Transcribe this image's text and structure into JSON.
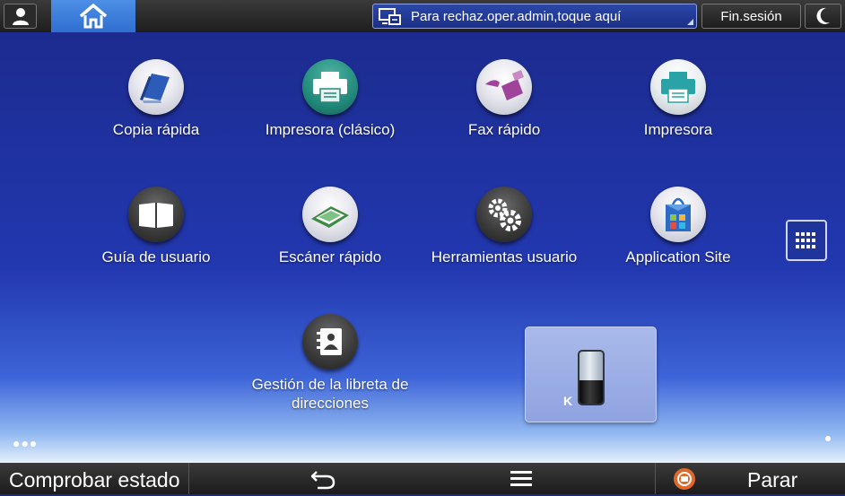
{
  "topbar": {
    "user_icon": "user-icon",
    "home_icon": "home-icon",
    "message": "Para rechaz.oper.admin,toque aquí",
    "message_icon": "monitor-icon",
    "logout_label": "Fin.sesión",
    "sleep_icon": "moon-icon"
  },
  "apps": [
    {
      "label": "Copia rápida",
      "icon": "copy-icon"
    },
    {
      "label": "Impresora (clásico)",
      "icon": "printer-icon"
    },
    {
      "label": "Fax rápido",
      "icon": "fax-icon"
    },
    {
      "label": "Impresora",
      "icon": "printer-icon"
    },
    {
      "label": "Guía de usuario",
      "icon": "book-icon"
    },
    {
      "label": "Escáner rápido",
      "icon": "scanner-icon"
    },
    {
      "label": "Herramientas usuario",
      "icon": "gears-icon"
    },
    {
      "label": "Application Site",
      "icon": "shopping-bag-icon"
    },
    {
      "label": "Gestión de la libreta de direcciones",
      "icon": "address-book-icon"
    }
  ],
  "toner_widget": {
    "color_label": "K",
    "level": 0.45
  },
  "bottombar": {
    "status_label": "Comprobar estado",
    "back_icon": "back-arrow-icon",
    "menu_icon": "menu-icon",
    "stop_label": "Parar",
    "stop_icon": "stop-icon"
  },
  "colors": {
    "accent": "#2f6fd0",
    "stop": "#e0682b"
  }
}
